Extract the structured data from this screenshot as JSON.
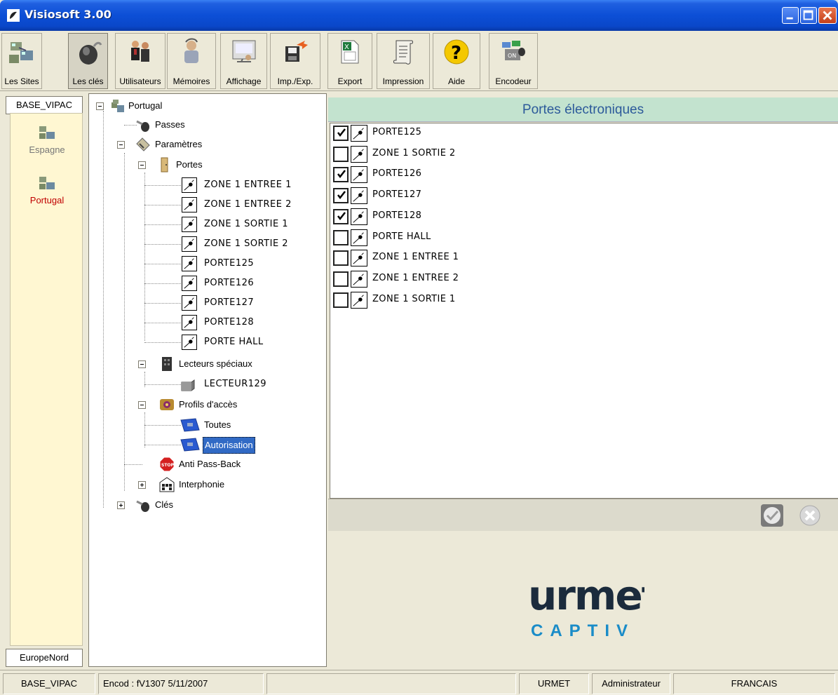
{
  "window": {
    "title": "Visiosoft 3.00"
  },
  "toolbar": {
    "buttons": [
      {
        "label": "Les Sites",
        "icon": "sites-icon"
      },
      {
        "label": "Les clés",
        "icon": "key-fob-icon"
      },
      {
        "label": "Utilisateurs",
        "icon": "users-icon"
      },
      {
        "label": "Mémoires",
        "icon": "memory-icon"
      },
      {
        "label": "Affichage",
        "icon": "display-icon"
      },
      {
        "label": "Imp./Exp.",
        "icon": "import-export-icon"
      },
      {
        "label": "Export",
        "icon": "excel-export-icon"
      },
      {
        "label": "Impression",
        "icon": "printer-scroll-icon"
      },
      {
        "label": "Aide",
        "icon": "help-icon"
      },
      {
        "label": "Encodeur",
        "icon": "encoder-icon"
      }
    ]
  },
  "sites": {
    "top_header": "BASE_VIPAC",
    "items": [
      {
        "label": "Espagne",
        "selected": false
      },
      {
        "label": "Portugal",
        "selected": true
      }
    ],
    "bottom_header": "EuropeNord"
  },
  "tree": {
    "root": "Portugal",
    "passes": "Passes",
    "parametres": "Paramètres",
    "portes": "Portes",
    "doors": [
      "ZONE 1 ENTREE 1",
      "ZONE 1 ENTREE 2",
      "ZONE 1 SORTIE 1",
      "ZONE 1 SORTIE 2",
      "PORTE125",
      "PORTE126",
      "PORTE127",
      "PORTE128",
      "PORTE HALL"
    ],
    "lecteurs": "Lecteurs spéciaux",
    "lecteur_item": "LECTEUR129",
    "profils": "Profils d'accès",
    "profil_toutes": "Toutes",
    "profil_autorisation": "Autorisation",
    "antipassback": "Anti Pass-Back",
    "interphonie": "Interphonie",
    "cles": "Clés"
  },
  "panel": {
    "title": "Portes électroniques",
    "doors": [
      {
        "label": "PORTE125",
        "checked": true
      },
      {
        "label": "ZONE 1 SORTIE 2",
        "checked": false
      },
      {
        "label": "PORTE126",
        "checked": true
      },
      {
        "label": "PORTE127",
        "checked": true
      },
      {
        "label": "PORTE128",
        "checked": true
      },
      {
        "label": "PORTE HALL",
        "checked": false
      },
      {
        "label": "ZONE 1 ENTREE 1",
        "checked": false
      },
      {
        "label": "ZONE 1 ENTREE 2",
        "checked": false
      },
      {
        "label": "ZONE 1 SORTIE 1",
        "checked": false
      }
    ]
  },
  "logo": {
    "brand": "urmet",
    "sub": "CAPTIV",
    "brand_color": "#1b2b3c",
    "sub_color": "#1a8cc8"
  },
  "statusbar": {
    "base": "BASE_VIPAC",
    "encod": "Encod : fV1307  5/11/2007",
    "vendor": "URMET",
    "user": "Administrateur",
    "language": "FRANCAIS"
  },
  "colors": {
    "accent_selection": "#316ac5",
    "panel_header": "#c3e3cf",
    "site_selected": "#c00000"
  }
}
